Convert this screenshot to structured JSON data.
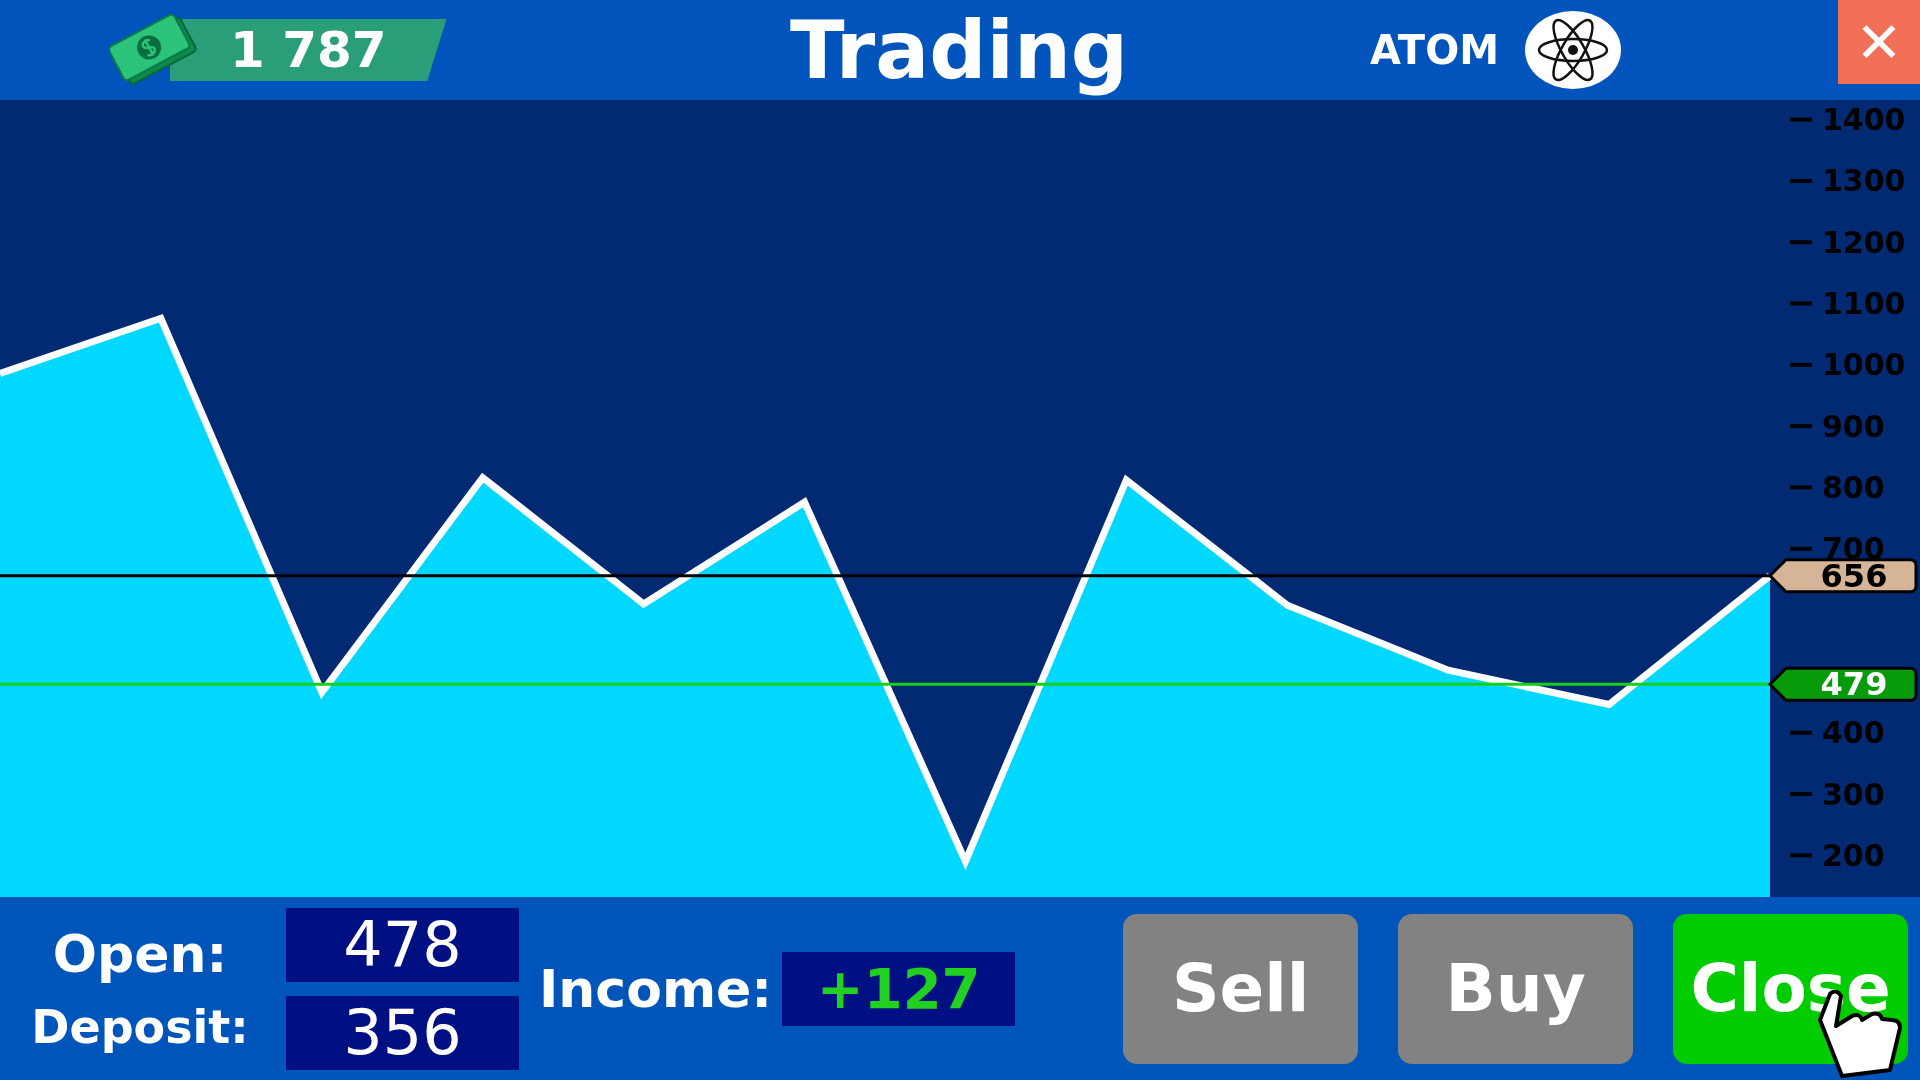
{
  "header": {
    "balance": "1 787",
    "title": "Trading",
    "asset": "ATOM",
    "close_label": "✕"
  },
  "chart": {
    "chart_data": {
      "type": "area",
      "categories": [
        null,
        null,
        null,
        null,
        null,
        null,
        null,
        null,
        null,
        null,
        null,
        null
      ],
      "series": [
        {
          "color": "#00d8ff",
          "values": [
            986,
            1076,
            466,
            816,
            610,
            776,
            190,
            812,
            608,
            502,
            446,
            656
          ]
        }
      ],
      "ylim": [
        132,
        1432
      ],
      "yticks": [
        200,
        300,
        400,
        700,
        800,
        900,
        1000,
        1100,
        1200,
        1300,
        1400
      ],
      "ref_lines": [
        {
          "axis": "y",
          "value": 656,
          "label": "656",
          "color": "#000000"
        },
        {
          "axis": "y",
          "value": 479,
          "label": "479",
          "color": "#16d016"
        }
      ]
    }
  },
  "footer": {
    "open_label": "Open:",
    "open_value": "478",
    "deposit_label": "Deposit:",
    "deposit_value": "356",
    "income_label": "Income:",
    "income_value": "+127",
    "buttons": [
      {
        "label": "Sell",
        "kind": "sell"
      },
      {
        "label": "Buy",
        "kind": "buy"
      },
      {
        "label": "Close",
        "kind": "close"
      }
    ]
  }
}
